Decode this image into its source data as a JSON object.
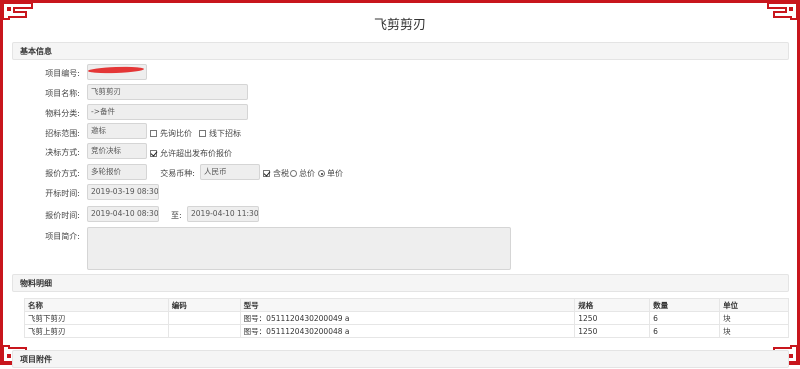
{
  "page_title": "飞剪剪刃",
  "sections": {
    "basic_info": "基本信息",
    "materials": "物料明细",
    "attachments": "项目附件"
  },
  "form": {
    "project_no": {
      "label": "项目编号:",
      "value": ""
    },
    "project_name": {
      "label": "项目名称:",
      "value": "飞剪剪刃"
    },
    "material_category": {
      "label": "物料分类:",
      "value": "->备件"
    },
    "bid_scope": {
      "label": "招标范围:",
      "value": "邀标",
      "options": [
        "先询比价",
        "线下招标"
      ]
    },
    "decision_method": {
      "label": "决标方式:",
      "value": "竞价决标",
      "option": "允许超出发布价报价"
    },
    "quote_method": {
      "label": "报价方式:",
      "value": "多轮报价"
    },
    "currency": {
      "label": "交易币种:",
      "value": "人民币",
      "tax_option": "含税",
      "price_options": [
        "总价",
        "单价"
      ]
    },
    "open_time": {
      "label": "开标时间:",
      "value": "2019-03-19 08:30"
    },
    "quote_time": {
      "label": "报价时间:",
      "start": "2019-04-10 08:30",
      "to_label": "至:",
      "end": "2019-04-10 11:30"
    },
    "summary": {
      "label": "项目简介:",
      "value": ""
    }
  },
  "materials_table": {
    "columns": [
      "名称",
      "编码",
      "型号",
      "规格",
      "数量",
      "单位"
    ],
    "rows": [
      [
        "飞剪下剪刃",
        "",
        "图号：0511120430200049 a",
        "1250",
        "6",
        "块"
      ],
      [
        "飞剪上剪刃",
        "",
        "图号：0511120430200048 a",
        "1250",
        "6",
        "块"
      ]
    ]
  },
  "colors": {
    "frame": "#c8161d",
    "field_bg": "#eeeeee",
    "section_bg": "#f5f5f5"
  }
}
